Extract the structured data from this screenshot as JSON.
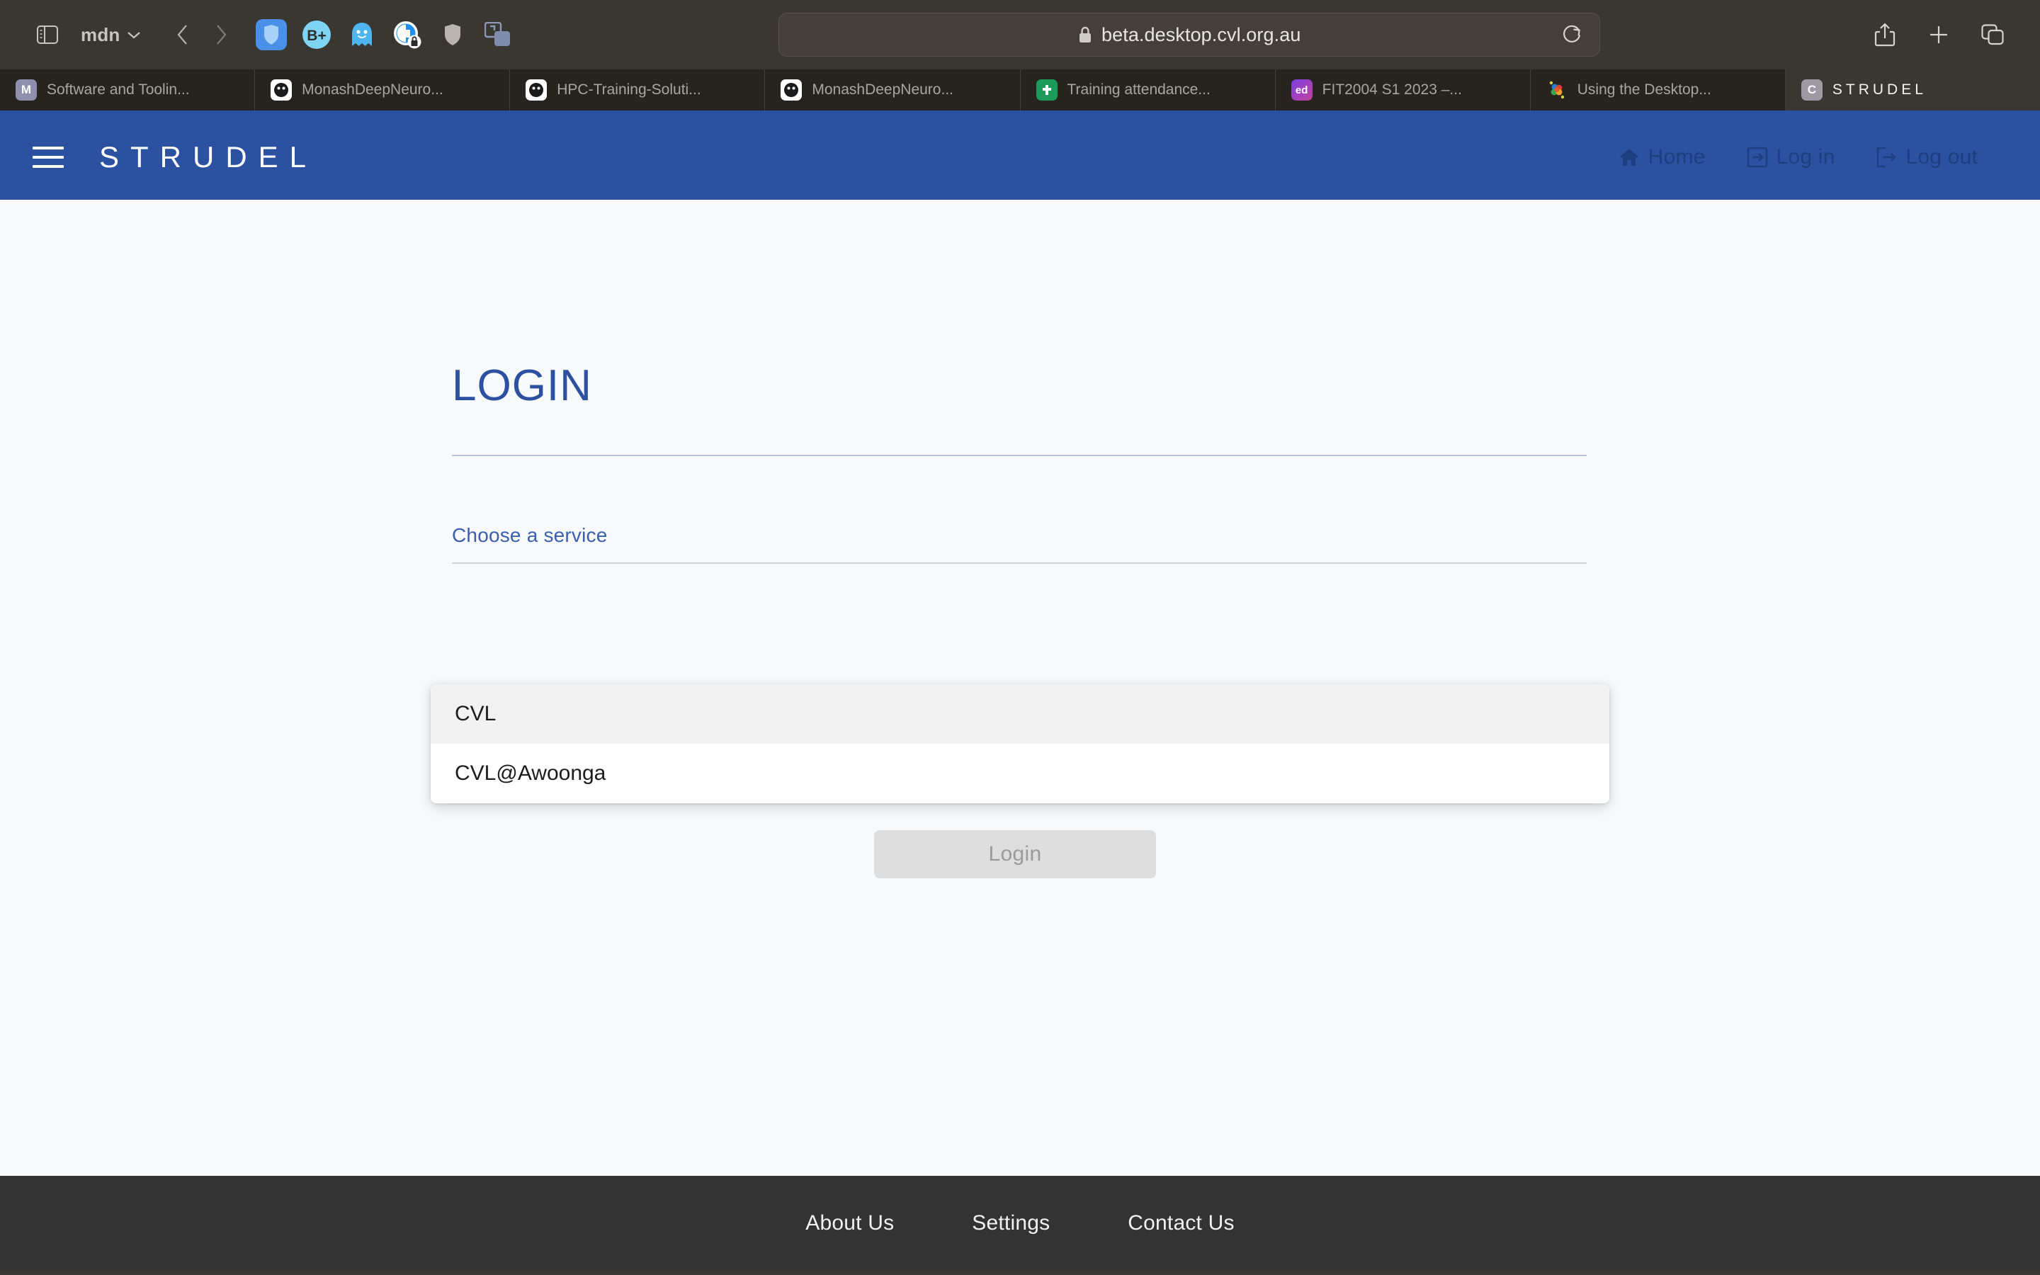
{
  "browser": {
    "profile_label": "mdn",
    "url": "beta.desktop.cvl.org.au",
    "lock_icon": "lock-icon",
    "reload_icon": "reload-icon",
    "sidebar_icon": "sidebar-toggle-icon",
    "back_icon": "back-arrow-icon",
    "forward_icon": "forward-arrow-icon",
    "share_icon": "share-icon",
    "new_tab_icon": "plus-icon",
    "tab_overview_icon": "tab-overview-icon",
    "extensions": [
      {
        "name": "bitwarden-extension-icon",
        "glyph": "shield"
      },
      {
        "name": "bplus-extension-icon",
        "glyph": "B+"
      },
      {
        "name": "ghostery-extension-icon",
        "glyph": "ghost"
      },
      {
        "name": "privacy-badger-extension-icon",
        "glyph": "privacy-lock"
      },
      {
        "name": "shield-extension-icon",
        "glyph": "shield-grey"
      },
      {
        "name": "window-extension-icon",
        "glyph": "window"
      }
    ],
    "tabs": [
      {
        "title": "Software and Toolin...",
        "favicon": "M",
        "favicon_class": "fav-m",
        "active": false
      },
      {
        "title": "MonashDeepNeuro...",
        "favicon": "github",
        "favicon_class": "fav-gh",
        "active": false
      },
      {
        "title": "HPC-Training-Soluti...",
        "favicon": "github",
        "favicon_class": "fav-gh",
        "active": false
      },
      {
        "title": "MonashDeepNeuro...",
        "favicon": "github",
        "favicon_class": "fav-gh",
        "active": false
      },
      {
        "title": "Training attendance...",
        "favicon": "sheets",
        "favicon_class": "fav-sheets",
        "active": false
      },
      {
        "title": "FIT2004 S1 2023 –...",
        "favicon": "ed",
        "favicon_class": "fav-ed",
        "active": false
      },
      {
        "title": "Using the Desktop...",
        "favicon": "hex",
        "favicon_class": "fav-hex",
        "active": false
      },
      {
        "title": "STRUDEL",
        "favicon": "C",
        "favicon_class": "fav-c",
        "active": true
      }
    ]
  },
  "app": {
    "brand": "STRUDEL",
    "menu_icon": "hamburger-menu-icon",
    "nav": [
      {
        "label": "Home",
        "icon": "home-icon"
      },
      {
        "label": "Log in",
        "icon": "login-icon"
      },
      {
        "label": "Log out",
        "icon": "logout-icon"
      }
    ]
  },
  "main": {
    "title": "LOGIN",
    "service_field": {
      "label": "Choose a service",
      "value": "",
      "options": [
        {
          "label": "CVL",
          "selected": true
        },
        {
          "label": "CVL@Awoonga",
          "selected": false
        }
      ]
    },
    "login_button": {
      "label": "Login",
      "disabled": true
    }
  },
  "footer": {
    "links": [
      {
        "label": "About Us"
      },
      {
        "label": "Settings"
      },
      {
        "label": "Contact Us"
      }
    ]
  },
  "colors": {
    "header_blue": "#2c51a1",
    "nav_text_blue": "#1e3e7f",
    "title_blue": "#2c51a1",
    "label_blue": "#3a5fae",
    "page_bg": "#f8f9fa",
    "footer_bg": "#333333",
    "browser_chrome": "#3a3733",
    "tabbar_bg": "#27241f",
    "button_disabled_bg": "#dedede",
    "dropdown_selected_bg": "#f2f2f2"
  }
}
